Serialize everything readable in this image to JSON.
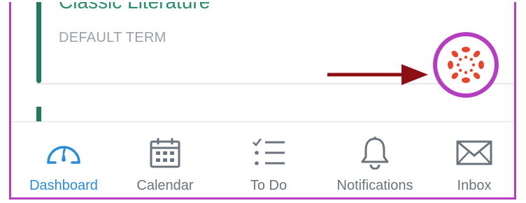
{
  "course_card": {
    "title": "Classic Literature",
    "term": "DEFAULT TERM",
    "color": "#217a5f"
  },
  "annotation": {
    "arrow_color": "#8b0f14",
    "highlight_color": "#b53ec0"
  },
  "canvas_logo": {
    "icon": "canvas-logo-icon",
    "color": "#e3472e"
  },
  "tabbar": {
    "tabs": [
      {
        "label": "Dashboard",
        "icon": "dashboard-icon",
        "active": true
      },
      {
        "label": "Calendar",
        "icon": "calendar-icon",
        "active": false
      },
      {
        "label": "To Do",
        "icon": "todo-list-icon",
        "active": false
      },
      {
        "label": "Notifications",
        "icon": "bell-icon",
        "active": false
      },
      {
        "label": "Inbox",
        "icon": "envelope-icon",
        "active": false
      }
    ],
    "active_color": "#2a8bd8",
    "inactive_color": "#6b737d"
  }
}
